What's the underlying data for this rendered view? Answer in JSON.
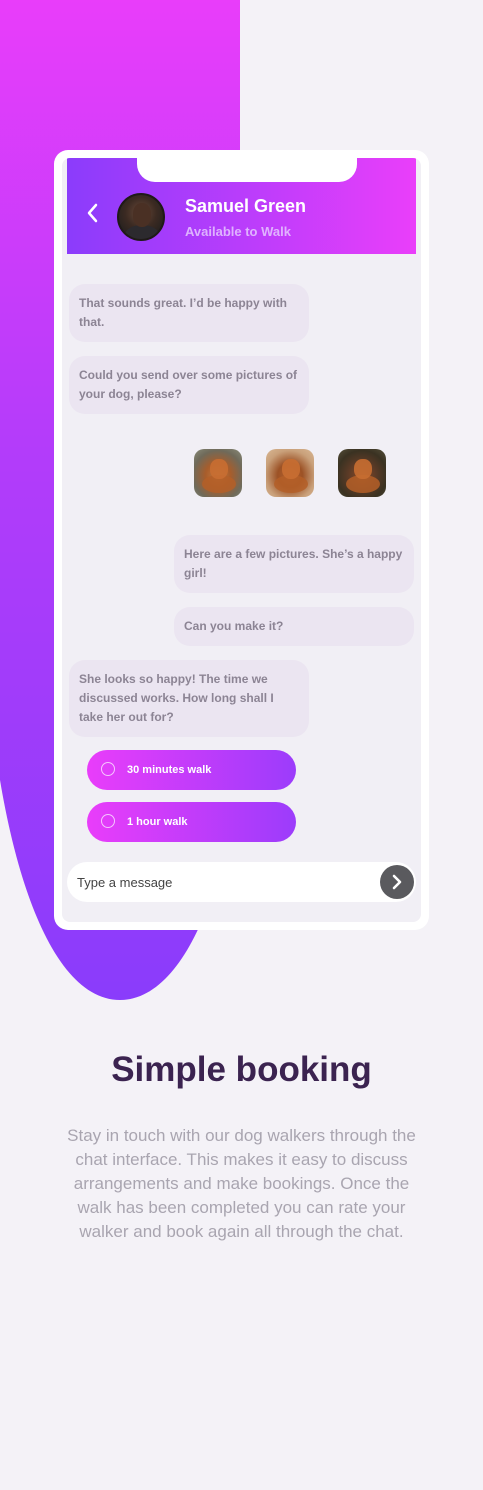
{
  "header": {
    "contact_name": "Samuel Green",
    "contact_status": "Available to Walk"
  },
  "messages": [
    {
      "direction": "in",
      "text": "That sounds great. I’d be happy with that."
    },
    {
      "direction": "in",
      "text": "Could you send over some pictures of your dog, please?"
    },
    {
      "direction": "out",
      "text": "Here are a few pictures. She’s a happy girl!"
    },
    {
      "direction": "out",
      "text": "Can you make it?"
    },
    {
      "direction": "in",
      "text": "She looks so happy! The time we discussed works. How long shall I take her out for?"
    }
  ],
  "options": [
    {
      "label": "30 minutes walk"
    },
    {
      "label": "1 hour walk"
    }
  ],
  "composer": {
    "placeholder": "Type a message"
  },
  "section": {
    "title": "Simple booking",
    "body": "Stay in touch with our dog walkers through the chat interface. This makes it easy to discuss arrangements and make bookings. Once the walk has been completed you can rate your walker and book again all through the chat."
  },
  "colors": {
    "accent_start": "#e93dfa",
    "accent_end": "#8b3cfb",
    "title": "#3b2350",
    "background": "#f4f2f7"
  }
}
